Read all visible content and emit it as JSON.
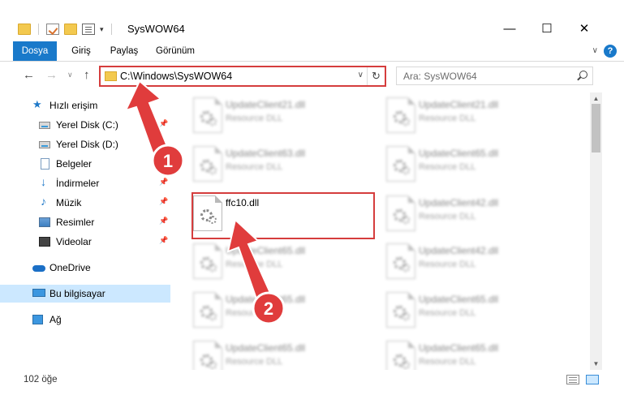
{
  "window": {
    "title": "SysWOW64",
    "minimize": "—",
    "maximize": "☐",
    "close": "✕"
  },
  "ribbon": {
    "tabs": [
      "Dosya",
      "Giriş",
      "Paylaş",
      "Görünüm"
    ],
    "accent": "#1979ca",
    "help": "?"
  },
  "navigation": {
    "back": "←",
    "forward": "→",
    "recent": "∨",
    "up": "↑",
    "address": "C:\\Windows\\SysWOW64",
    "refresh": "↻",
    "search_placeholder": "Ara: SysWOW64"
  },
  "sidebar": {
    "items": [
      {
        "label": "Hızlı erişim",
        "icon": "star-icon",
        "pinned": false
      },
      {
        "label": "Yerel Disk (C:)",
        "icon": "disk-icon",
        "pinned": true
      },
      {
        "label": "Yerel Disk (D:)",
        "icon": "disk-icon",
        "pinned": false
      },
      {
        "label": "Belgeler",
        "icon": "document-icon",
        "pinned": false
      },
      {
        "label": "İndirmeler",
        "icon": "download-icon",
        "pinned": true
      },
      {
        "label": "Müzik",
        "icon": "music-icon",
        "pinned": true
      },
      {
        "label": "Resimler",
        "icon": "pictures-icon",
        "pinned": true
      },
      {
        "label": "Videolar",
        "icon": "videos-icon",
        "pinned": true
      },
      {
        "label": "OneDrive",
        "icon": "cloud-icon",
        "pinned": false
      },
      {
        "label": "Bu bilgisayar",
        "icon": "computer-icon",
        "pinned": false,
        "selected": true
      },
      {
        "label": "Ağ",
        "icon": "network-icon",
        "pinned": false
      }
    ]
  },
  "files": [
    {
      "name": "UpdateClient21.dll",
      "type": "Resource DLL",
      "blurred": true
    },
    {
      "name": "UpdateClient21.dll",
      "type": "Resource DLL",
      "blurred": true
    },
    {
      "name": "UpdateClient63.dll",
      "type": "Resource DLL",
      "blurred": true
    },
    {
      "name": "UpdateClient65.dll",
      "type": "Resource DLL",
      "blurred": true
    },
    {
      "name": "ffc10.dll",
      "type": "",
      "blurred": false,
      "highlighted": true
    },
    {
      "name": "UpdateClient42.dll",
      "type": "Resource DLL",
      "blurred": true
    },
    {
      "name": "UpdateClient65.dll",
      "type": "Resource DLL",
      "blurred": true
    },
    {
      "name": "UpdateClient42.dll",
      "type": "Resource DLL",
      "blurred": true
    },
    {
      "name": "UpdateClient65.dll",
      "type": "Resource DLL",
      "blurred": true
    },
    {
      "name": "UpdateClient65.dll",
      "type": "Resource DLL",
      "blurred": true
    },
    {
      "name": "UpdateClient65.dll",
      "type": "Resource DLL",
      "blurred": true
    },
    {
      "name": "UpdateClient65.dll",
      "type": "Resource DLL",
      "blurred": true
    }
  ],
  "status": {
    "item_count": "102 öğe"
  },
  "callouts": [
    {
      "number": "1",
      "color": "#e03c3c"
    },
    {
      "number": "2",
      "color": "#e03c3c"
    }
  ]
}
